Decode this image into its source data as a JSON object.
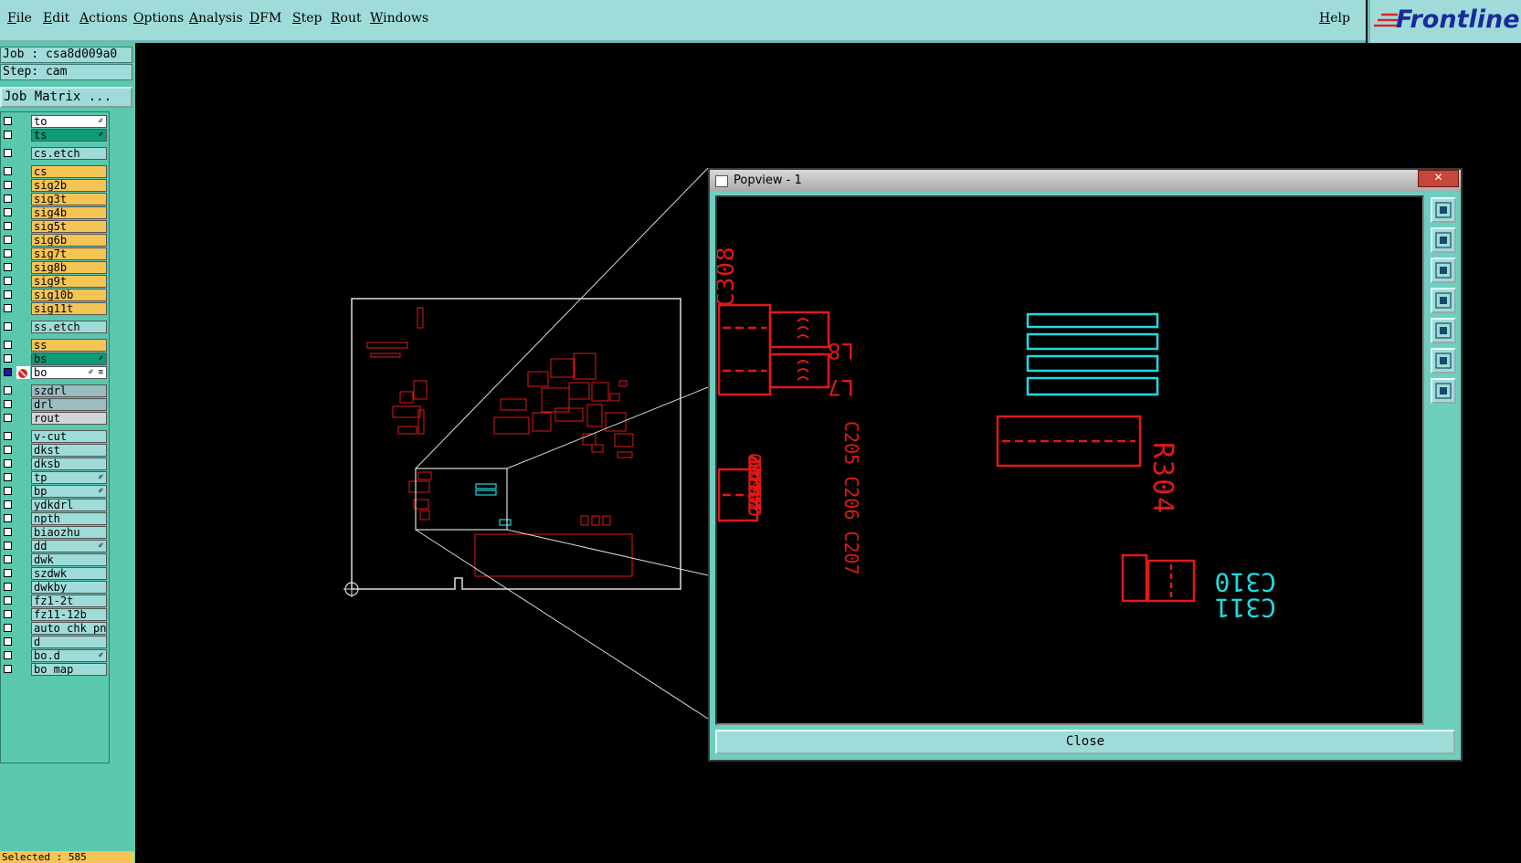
{
  "menu": [
    "File",
    "Edit",
    "Actions",
    "Options",
    "Analysis",
    "DFM",
    "Step",
    "Rout",
    "Windows"
  ],
  "help": "Help",
  "brand": "Frontline",
  "job": "Job : csa8d009a0",
  "step": "Step: cam",
  "job_matrix": "Job Matrix ...",
  "layers": [
    {
      "name": "to",
      "color": "#ffffff",
      "flag": "✐"
    },
    {
      "name": "ts",
      "color": "#0e9c78",
      "flag": "✐"
    },
    {
      "name": "cs.etch",
      "color": "#9fdcd9",
      "flag": ""
    },
    {
      "name": "cs",
      "color": "#f4c454",
      "flag": ""
    },
    {
      "name": "sig2b",
      "color": "#f4c454",
      "flag": ""
    },
    {
      "name": "sig3t",
      "color": "#f4c454",
      "flag": ""
    },
    {
      "name": "sig4b",
      "color": "#f4c454",
      "flag": ""
    },
    {
      "name": "sig5t",
      "color": "#f4c454",
      "flag": ""
    },
    {
      "name": "sig6b",
      "color": "#f4c454",
      "flag": ""
    },
    {
      "name": "sig7t",
      "color": "#f4c454",
      "flag": ""
    },
    {
      "name": "sig8b",
      "color": "#f4c454",
      "flag": ""
    },
    {
      "name": "sig9t",
      "color": "#f4c454",
      "flag": ""
    },
    {
      "name": "sig10b",
      "color": "#f4c454",
      "flag": ""
    },
    {
      "name": "sig11t",
      "color": "#f4c454",
      "flag": ""
    },
    {
      "name": "ss.etch",
      "color": "#9fdcd9",
      "flag": ""
    },
    {
      "name": "ss",
      "color": "#f4c454",
      "flag": ""
    },
    {
      "name": "bs",
      "color": "#0e9c78",
      "flag": "✐"
    },
    {
      "name": "bo",
      "color": "#ffffff",
      "flag": "✐ ≡"
    },
    {
      "name": "szdrl",
      "color": "#9bbcc0",
      "flag": ""
    },
    {
      "name": "drl",
      "color": "#9bbcc0",
      "flag": ""
    },
    {
      "name": "rout",
      "color": "#d0d6d6",
      "flag": ""
    },
    {
      "name": "v-cut",
      "color": "#9fdcd9",
      "flag": ""
    },
    {
      "name": "dkst",
      "color": "#9fdcd9",
      "flag": ""
    },
    {
      "name": "dksb",
      "color": "#9fdcd9",
      "flag": ""
    },
    {
      "name": "tp",
      "color": "#9fdcd9",
      "flag": "✐"
    },
    {
      "name": "bp",
      "color": "#9fdcd9",
      "flag": "✐"
    },
    {
      "name": "ydkdrl",
      "color": "#9fdcd9",
      "flag": ""
    },
    {
      "name": "npth",
      "color": "#9fdcd9",
      "flag": ""
    },
    {
      "name": "biaozhu",
      "color": "#9fdcd9",
      "flag": ""
    },
    {
      "name": "dd",
      "color": "#9fdcd9",
      "flag": "✐"
    },
    {
      "name": "dwk",
      "color": "#9fdcd9",
      "flag": ""
    },
    {
      "name": "szdwk",
      "color": "#9fdcd9",
      "flag": ""
    },
    {
      "name": "dwkby",
      "color": "#9fdcd9",
      "flag": ""
    },
    {
      "name": "fz1-2t",
      "color": "#9fdcd9",
      "flag": ""
    },
    {
      "name": "fz11-12b",
      "color": "#9fdcd9",
      "flag": ""
    },
    {
      "name": "auto_chk_pnl",
      "color": "#9fdcd9",
      "flag": ""
    },
    {
      "name": "d",
      "color": "#9fdcd9",
      "flag": ""
    },
    {
      "name": "bo.d",
      "color": "#9fdcd9",
      "flag": "✐"
    },
    {
      "name": "bo_map",
      "color": "#9fdcd9",
      "flag": ""
    }
  ],
  "selected": "Selected : 585",
  "popup": {
    "title": "Popview - 1",
    "close_x": "✕",
    "close": "Close",
    "labels": {
      "c308": "C308",
      "l8": "L8",
      "l7": "L7",
      "c205_group": "C205 C206 C207",
      "r304": "R304",
      "c310": "C310",
      "c311": "C311",
      "c_group": "C213 C214 C215 C216 C217 C218 C219 C220"
    }
  }
}
